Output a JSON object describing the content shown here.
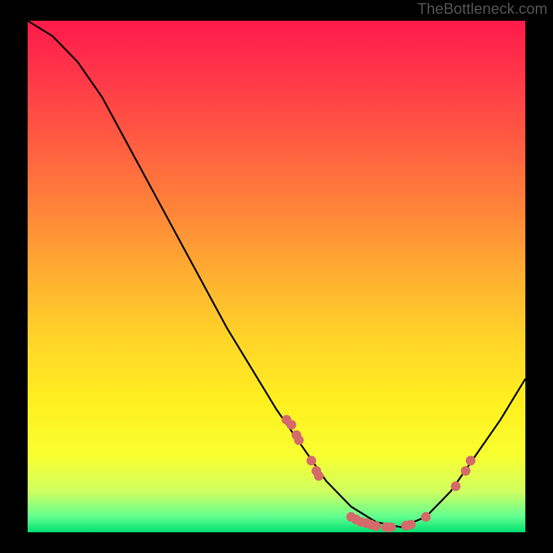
{
  "watermark": "TheBottleneck.com",
  "chart_data": {
    "type": "line",
    "title": "",
    "xlabel": "",
    "ylabel": "",
    "xlim": [
      0,
      100
    ],
    "ylim": [
      0,
      100
    ],
    "curve": [
      {
        "x": 0,
        "y": 100
      },
      {
        "x": 5,
        "y": 97
      },
      {
        "x": 10,
        "y": 92
      },
      {
        "x": 15,
        "y": 85
      },
      {
        "x": 20,
        "y": 76
      },
      {
        "x": 25,
        "y": 67
      },
      {
        "x": 30,
        "y": 58
      },
      {
        "x": 35,
        "y": 49
      },
      {
        "x": 40,
        "y": 40
      },
      {
        "x": 45,
        "y": 32
      },
      {
        "x": 50,
        "y": 24
      },
      {
        "x": 55,
        "y": 17
      },
      {
        "x": 60,
        "y": 10
      },
      {
        "x": 65,
        "y": 5
      },
      {
        "x": 70,
        "y": 2
      },
      {
        "x": 75,
        "y": 1
      },
      {
        "x": 80,
        "y": 3
      },
      {
        "x": 85,
        "y": 8
      },
      {
        "x": 90,
        "y": 15
      },
      {
        "x": 95,
        "y": 22
      },
      {
        "x": 100,
        "y": 30
      }
    ],
    "points": [
      {
        "x": 52,
        "y": 22
      },
      {
        "x": 53,
        "y": 21
      },
      {
        "x": 54,
        "y": 19
      },
      {
        "x": 54.5,
        "y": 18
      },
      {
        "x": 57,
        "y": 14
      },
      {
        "x": 58,
        "y": 12
      },
      {
        "x": 58.5,
        "y": 11
      },
      {
        "x": 65,
        "y": 3
      },
      {
        "x": 66,
        "y": 2.5
      },
      {
        "x": 67,
        "y": 2
      },
      {
        "x": 68,
        "y": 1.8
      },
      {
        "x": 69,
        "y": 1.5
      },
      {
        "x": 70,
        "y": 1.2
      },
      {
        "x": 72,
        "y": 1
      },
      {
        "x": 73,
        "y": 1
      },
      {
        "x": 76,
        "y": 1.3
      },
      {
        "x": 77,
        "y": 1.5
      },
      {
        "x": 80,
        "y": 3
      },
      {
        "x": 86,
        "y": 9
      },
      {
        "x": 88,
        "y": 12
      },
      {
        "x": 89,
        "y": 14
      }
    ],
    "gradient_colors": {
      "top": "#ff1a4a",
      "middle": "#ffd428",
      "bottom": "#00e070"
    }
  }
}
